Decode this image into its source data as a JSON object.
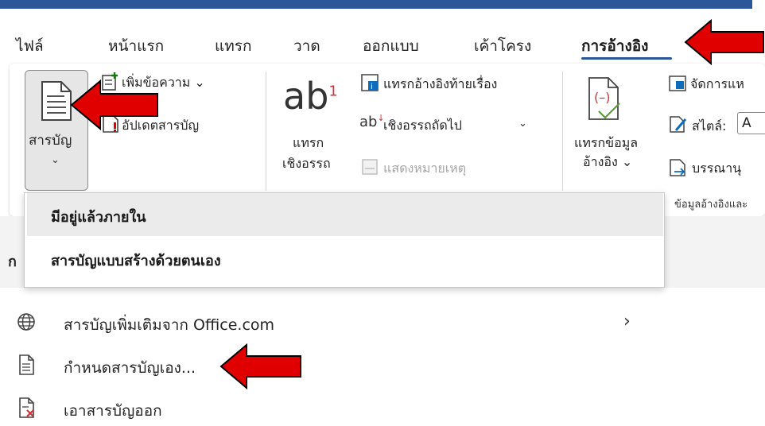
{
  "tabs": [
    {
      "label": "ไฟล์"
    },
    {
      "label": "หน้าแรก"
    },
    {
      "label": "แทรก"
    },
    {
      "label": "วาด"
    },
    {
      "label": "ออกแบบ"
    },
    {
      "label": "เค้าโครง"
    },
    {
      "label": "การอ้างอิง"
    }
  ],
  "ribbon": {
    "toc": {
      "label": "สารบัญ"
    },
    "add_text": "เพิ่มข้อความ",
    "update_table": "อัปเดตสารบัญ",
    "footnote_ab": "ab",
    "footnote_sup": "1",
    "insert_footnote_line1": "แทรก",
    "insert_footnote_line2": "เชิงอรรถ",
    "insert_endnote": "แทรกอ้างอิงท้ายเรื่อง",
    "next_footnote": "เชิงอรรถถัดไป",
    "show_notes": "แสดงหมายเหตุ",
    "insert_citation_line1": "แทรกข้อมูล",
    "insert_citation_line2": "อ้างอิง",
    "manage_sources": "จัดการแห",
    "style_label": "สไตล์:",
    "style_value": "A",
    "bibliography": "บรรณานุ",
    "group_citations": "ข้อมูลอ้างอิงและ"
  },
  "dropdown": {
    "builtin_header": "มีอยู่แล้วภายใน",
    "manual_header": "สารบัญแบบสร้างด้วยตนเอง"
  },
  "doc_left_char": "ก",
  "menu": [
    {
      "label": "สารบัญเพิ่มเติมจาก Office.com",
      "has_submenu": true,
      "icon": "globe-icon"
    },
    {
      "label": "กำหนดสารบัญเอง...",
      "has_submenu": false,
      "icon": "document-icon"
    },
    {
      "label": "เอาสารบัญออก",
      "has_submenu": false,
      "icon": "remove-document-icon"
    }
  ],
  "colors": {
    "accent": "#2b579a",
    "annotation_arrow": "#e00000",
    "footnote_sup": "#d13438"
  }
}
